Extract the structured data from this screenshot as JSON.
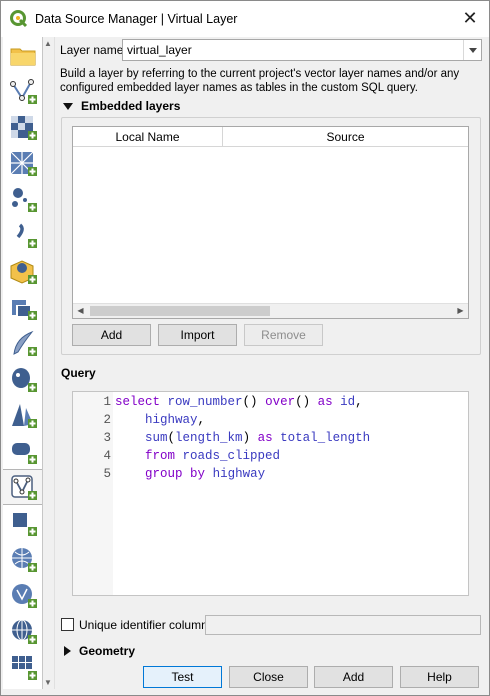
{
  "window": {
    "title": "Data Source Manager | Virtual Layer",
    "close": "✕"
  },
  "sidebar": {
    "items": [
      {
        "name": "browser",
        "icon": "folder-icon",
        "active": false
      },
      {
        "name": "vector",
        "icon": "vector-layer-icon",
        "active": false
      },
      {
        "name": "raster",
        "icon": "raster-layer-icon",
        "active": false
      },
      {
        "name": "mesh",
        "icon": "mesh-layer-icon",
        "active": false
      },
      {
        "name": "delimited-text",
        "icon": "delimited-text-icon",
        "active": false
      },
      {
        "name": "gps",
        "icon": "gps-icon",
        "active": false
      },
      {
        "name": "geopackage",
        "icon": "geopackage-icon",
        "active": false
      },
      {
        "name": "spatialite",
        "icon": "spatialite-icon",
        "active": false
      },
      {
        "name": "postgresql",
        "icon": "postgresql-icon",
        "active": false
      },
      {
        "name": "mssql",
        "icon": "mssql-icon",
        "active": false
      },
      {
        "name": "oracle",
        "icon": "oracle-icon",
        "active": false
      },
      {
        "name": "virtual-layer",
        "icon": "virtual-layer-icon",
        "active": true
      },
      {
        "name": "wms",
        "icon": "wms-icon",
        "active": false
      },
      {
        "name": "wcs",
        "icon": "wcs-icon",
        "active": false
      },
      {
        "name": "wfs",
        "icon": "wfs-icon",
        "active": false
      },
      {
        "name": "arcgis",
        "icon": "arcgis-icon",
        "active": false
      },
      {
        "name": "xyz",
        "icon": "xyz-tiles-icon",
        "active": false
      }
    ]
  },
  "layer_name": {
    "label": "Layer name",
    "value": "virtual_layer"
  },
  "description": "Build a layer by referring to the current project's vector layer names and/or any configured embedded layer names as tables in the custom SQL query.",
  "embedded": {
    "title": "Embedded layers",
    "columns": [
      "Local Name",
      "Source"
    ],
    "buttons": {
      "add": "Add",
      "import": "Import",
      "remove": "Remove"
    }
  },
  "query": {
    "title": "Query",
    "lines": [
      {
        "num": "1",
        "text": "select row_number() over() as id,"
      },
      {
        "num": "2",
        "text": "    highway,"
      },
      {
        "num": "3",
        "text": "    sum(length_km) as total_length"
      },
      {
        "num": "4",
        "text": "    from roads_clipped"
      },
      {
        "num": "5",
        "text": "    group by highway"
      }
    ]
  },
  "unique_id": {
    "label": "Unique identifier column",
    "checked": false,
    "value": ""
  },
  "geometry": {
    "title": "Geometry"
  },
  "footer": {
    "test": "Test",
    "close": "Close",
    "add": "Add",
    "help": "Help"
  },
  "colors": {
    "qgis_green": "#589632",
    "accent_blue": "#0078d7",
    "keyword_purple": "#8200c8"
  }
}
